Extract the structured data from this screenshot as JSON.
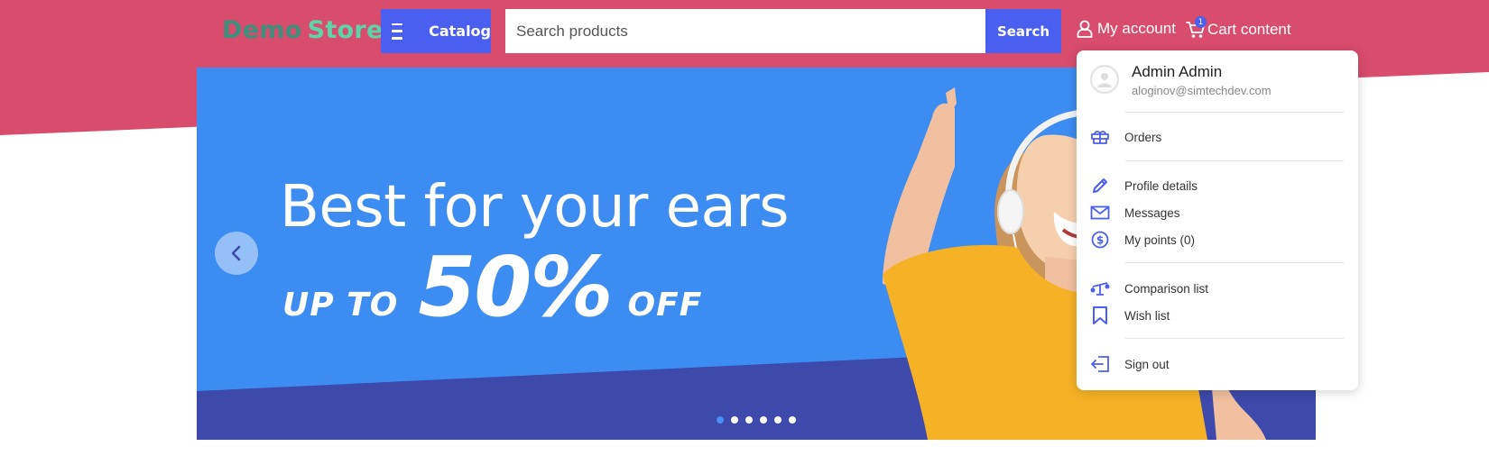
{
  "header": {
    "logo_word1": "Demo",
    "logo_word2": "Store",
    "catalog_label": "Catalog",
    "search_placeholder": "Search products",
    "search_button": "Search",
    "account_label": "My account",
    "cart_label": "Cart content",
    "cart_count": "1"
  },
  "banner": {
    "headline": "Best for your ears",
    "promo_prefix": "UP TO",
    "promo_value": "50%",
    "promo_suffix": "OFF",
    "slides_total": 6,
    "active_slide": 1
  },
  "account_menu": {
    "user_name": "Admin Admin",
    "user_email": "aloginov@simtechdev.com",
    "items": [
      {
        "label": "Orders",
        "icon": "box-icon"
      },
      {
        "label": "Profile details",
        "icon": "pencil-icon"
      },
      {
        "label": "Messages",
        "icon": "envelope-icon"
      },
      {
        "label": "My points (0)",
        "icon": "coin-icon"
      },
      {
        "label": "Comparison list",
        "icon": "scales-icon"
      },
      {
        "label": "Wish list",
        "icon": "bookmark-icon"
      },
      {
        "label": "Sign out",
        "icon": "sign-out-icon"
      }
    ]
  },
  "colors": {
    "header_bg": "#d84c6d",
    "accent": "#4a5ff0",
    "banner_blue": "#3c8cf1",
    "banner_dark": "#3d49ab",
    "logo_dark": "#3f8f7c",
    "logo_light": "#5fd3a8",
    "shirt": "#f6b226"
  }
}
